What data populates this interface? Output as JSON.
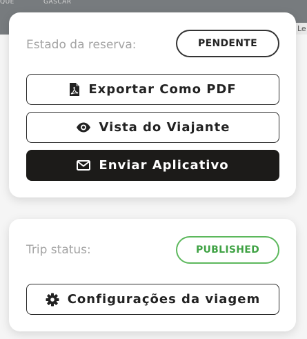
{
  "map": {
    "labels": [
      "QUE",
      "GASCAR"
    ],
    "attribution": "Le"
  },
  "booking": {
    "status_label": "Estado da reserva:",
    "status_badge": "PENDENTE",
    "export_pdf_label": "Exportar Como PDF",
    "export_pdf_icon": "file-pdf-icon",
    "traveler_view_label": "Vista do Viajante",
    "traveler_view_icon": "eye-icon",
    "send_app_label": "Enviar Aplicativo",
    "send_app_icon": "envelope-icon"
  },
  "trip": {
    "status_label": "Trip status:",
    "status_badge": "PUBLISHED",
    "settings_label": "Configurações da viagem",
    "settings_icon": "gear-icon"
  },
  "colors": {
    "dark_button": "#1c1b19",
    "published_green": "#5cb85c",
    "muted_label": "#a3a3a3"
  }
}
